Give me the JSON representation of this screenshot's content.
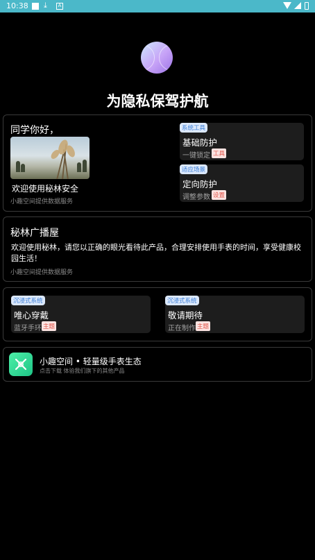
{
  "status_bar": {
    "time": "10:38",
    "icons": [
      "notification-square-icon",
      "download-icon",
      "a-icon",
      "wifi-icon",
      "signal-icon",
      "battery-icon"
    ]
  },
  "hero": {
    "logo": "purple-ball-logo",
    "headline": "为隐私保驾护航"
  },
  "greeting_card": {
    "title": "同学你好，",
    "image": "reed-grass-photo",
    "welcome": "欢迎使用秘林安全",
    "note": "小趣空间提供数据服务",
    "features": [
      {
        "tag": "系统工具",
        "title": "基础防护",
        "subtitle": "一键锁定",
        "badge": "工具"
      },
      {
        "tag": "适应场景",
        "title": "定向防护",
        "subtitle": "调整参数",
        "badge": "设置"
      }
    ]
  },
  "broadcast_card": {
    "title": "秘林广播屋",
    "body": "欢迎使用秘林，请您以正确的眼光看待此产品，合理安排使用手表的时间，享受健康校园生活！",
    "note": "小趣空间提供数据服务"
  },
  "theme_card": {
    "items": [
      {
        "tag": "沉浸式系统",
        "title": "唯心穿戴",
        "subtitle": "蓝牙手环",
        "badge": "主题"
      },
      {
        "tag": "沉浸式系统",
        "title": "敬请期待",
        "subtitle": "正在制作",
        "badge": "主题"
      }
    ]
  },
  "ecosystem_card": {
    "icon": "x-logo-icon",
    "title": "小趣空间 • 轻量级手表生态",
    "subtitle": "点击下载 体验我们旗下的其他产品"
  },
  "colors": {
    "background": "#000000",
    "status_bar": "#4bb8c9",
    "card_border": "#3a3a3a",
    "mini_card": "#1d1d1d",
    "tag_blue": "#3d7fd6",
    "tag_red": "#e2574c",
    "accent_green": "#2fd894"
  }
}
